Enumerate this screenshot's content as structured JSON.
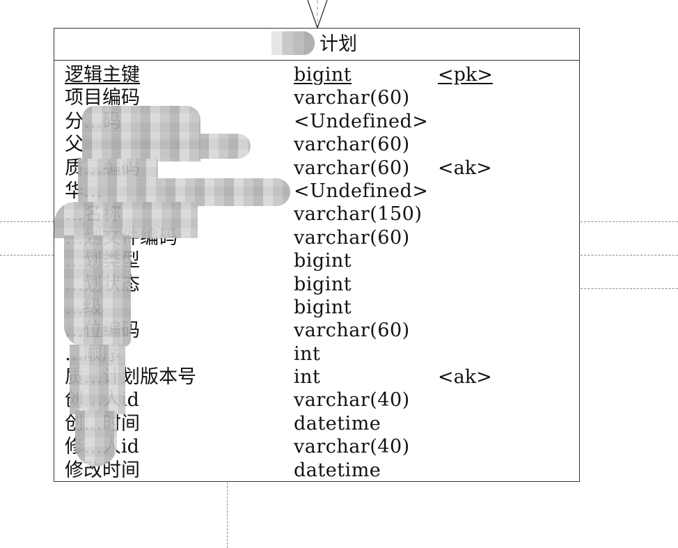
{
  "diagram": {
    "type": "entity-relationship / physical data model",
    "entity": {
      "title_visible": "计划",
      "title_obscured": true,
      "columns": [
        {
          "name": "逻辑主键",
          "type": "bigint",
          "key": "<pk>",
          "underlined": true
        },
        {
          "name": "项目编码",
          "type": "varchar(60)",
          "key": ""
        },
        {
          "name": "分…码",
          "type": "<Undefined>",
          "key": ""
        },
        {
          "name": "父…",
          "type": "varchar(60)",
          "key": ""
        },
        {
          "name": "质…编码",
          "type": "varchar(60)",
          "key": "<ak>"
        },
        {
          "name": "华…",
          "type": "<Undefined>",
          "key": ""
        },
        {
          "name": "…名称",
          "type": "varchar(150)",
          "key": ""
        },
        {
          "name": "…划文件编码",
          "type": "varchar(60)",
          "key": ""
        },
        {
          "name": "…划类型",
          "type": "bigint",
          "key": ""
        },
        {
          "name": "…划状态",
          "type": "bigint",
          "key": ""
        },
        {
          "name": "…级",
          "type": "bigint",
          "key": ""
        },
        {
          "name": "…位编码",
          "type": "varchar(60)",
          "key": ""
        },
        {
          "name": "…顺序",
          "type": "int",
          "key": ""
        },
        {
          "name": "质…计划版本号",
          "type": "int",
          "key": "<ak>"
        },
        {
          "name": "创…人id",
          "type": "varchar(40)",
          "key": ""
        },
        {
          "name": "创…时间",
          "type": "datetime",
          "key": ""
        },
        {
          "name": "修…人id",
          "type": "varchar(40)",
          "key": ""
        },
        {
          "name": "修改时间",
          "type": "datetime",
          "key": ""
        }
      ]
    },
    "connectors": {
      "top": "inheritance/relationship arrow (open triangle) pointing into entity",
      "left": "dashed links",
      "right": "dashed links",
      "bottom": "dashed link"
    },
    "colors": {
      "border": "#333333",
      "dash": "#8a8a8a",
      "text": "#111111",
      "background": "#ffffff"
    }
  }
}
